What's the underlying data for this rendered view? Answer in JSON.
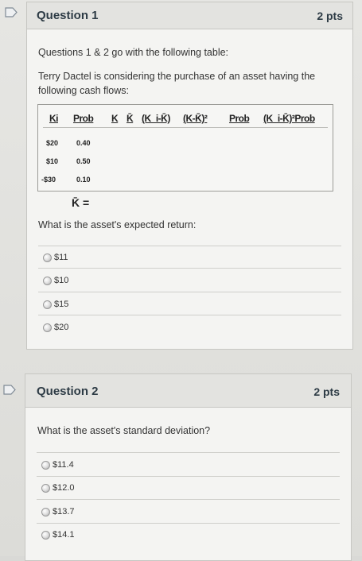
{
  "q1": {
    "title": "Question 1",
    "points": "2 pts",
    "intro": "Questions 1 & 2 go with the following table:",
    "body_line1": "Terry Dactel is considering the purchase of an asset having the",
    "body_line2": "following cash flows:",
    "table": {
      "headers": [
        "Ki",
        "Prob",
        "K",
        "K̄",
        "(K_i-K̄)",
        "(K-K̄)²",
        "Prob",
        "(K_i-K̄)²Prob"
      ],
      "rows": [
        {
          "ki": "$20",
          "prob": "0.40"
        },
        {
          "ki": "$10",
          "prob": "0.50"
        },
        {
          "ki": "-$30",
          "prob": "0.10"
        }
      ],
      "kbar_label": "K̄ ="
    },
    "prompt": "What is the asset's expected return:",
    "options": [
      "$11",
      "$10",
      "$15",
      "$20"
    ]
  },
  "q2": {
    "title": "Question 2",
    "points": "2 pts",
    "prompt": "What is the asset's standard deviation?",
    "options": [
      "$11.4",
      "$12.0",
      "$13.7",
      "$14.1"
    ]
  },
  "colors": {
    "flag": "#e8ecef",
    "flag_stroke": "#8a95a0",
    "card_bg": "#f4f4f2",
    "header_bg": "#e3e3e0"
  },
  "icons": [
    "flag-icon",
    "radio-icon"
  ]
}
